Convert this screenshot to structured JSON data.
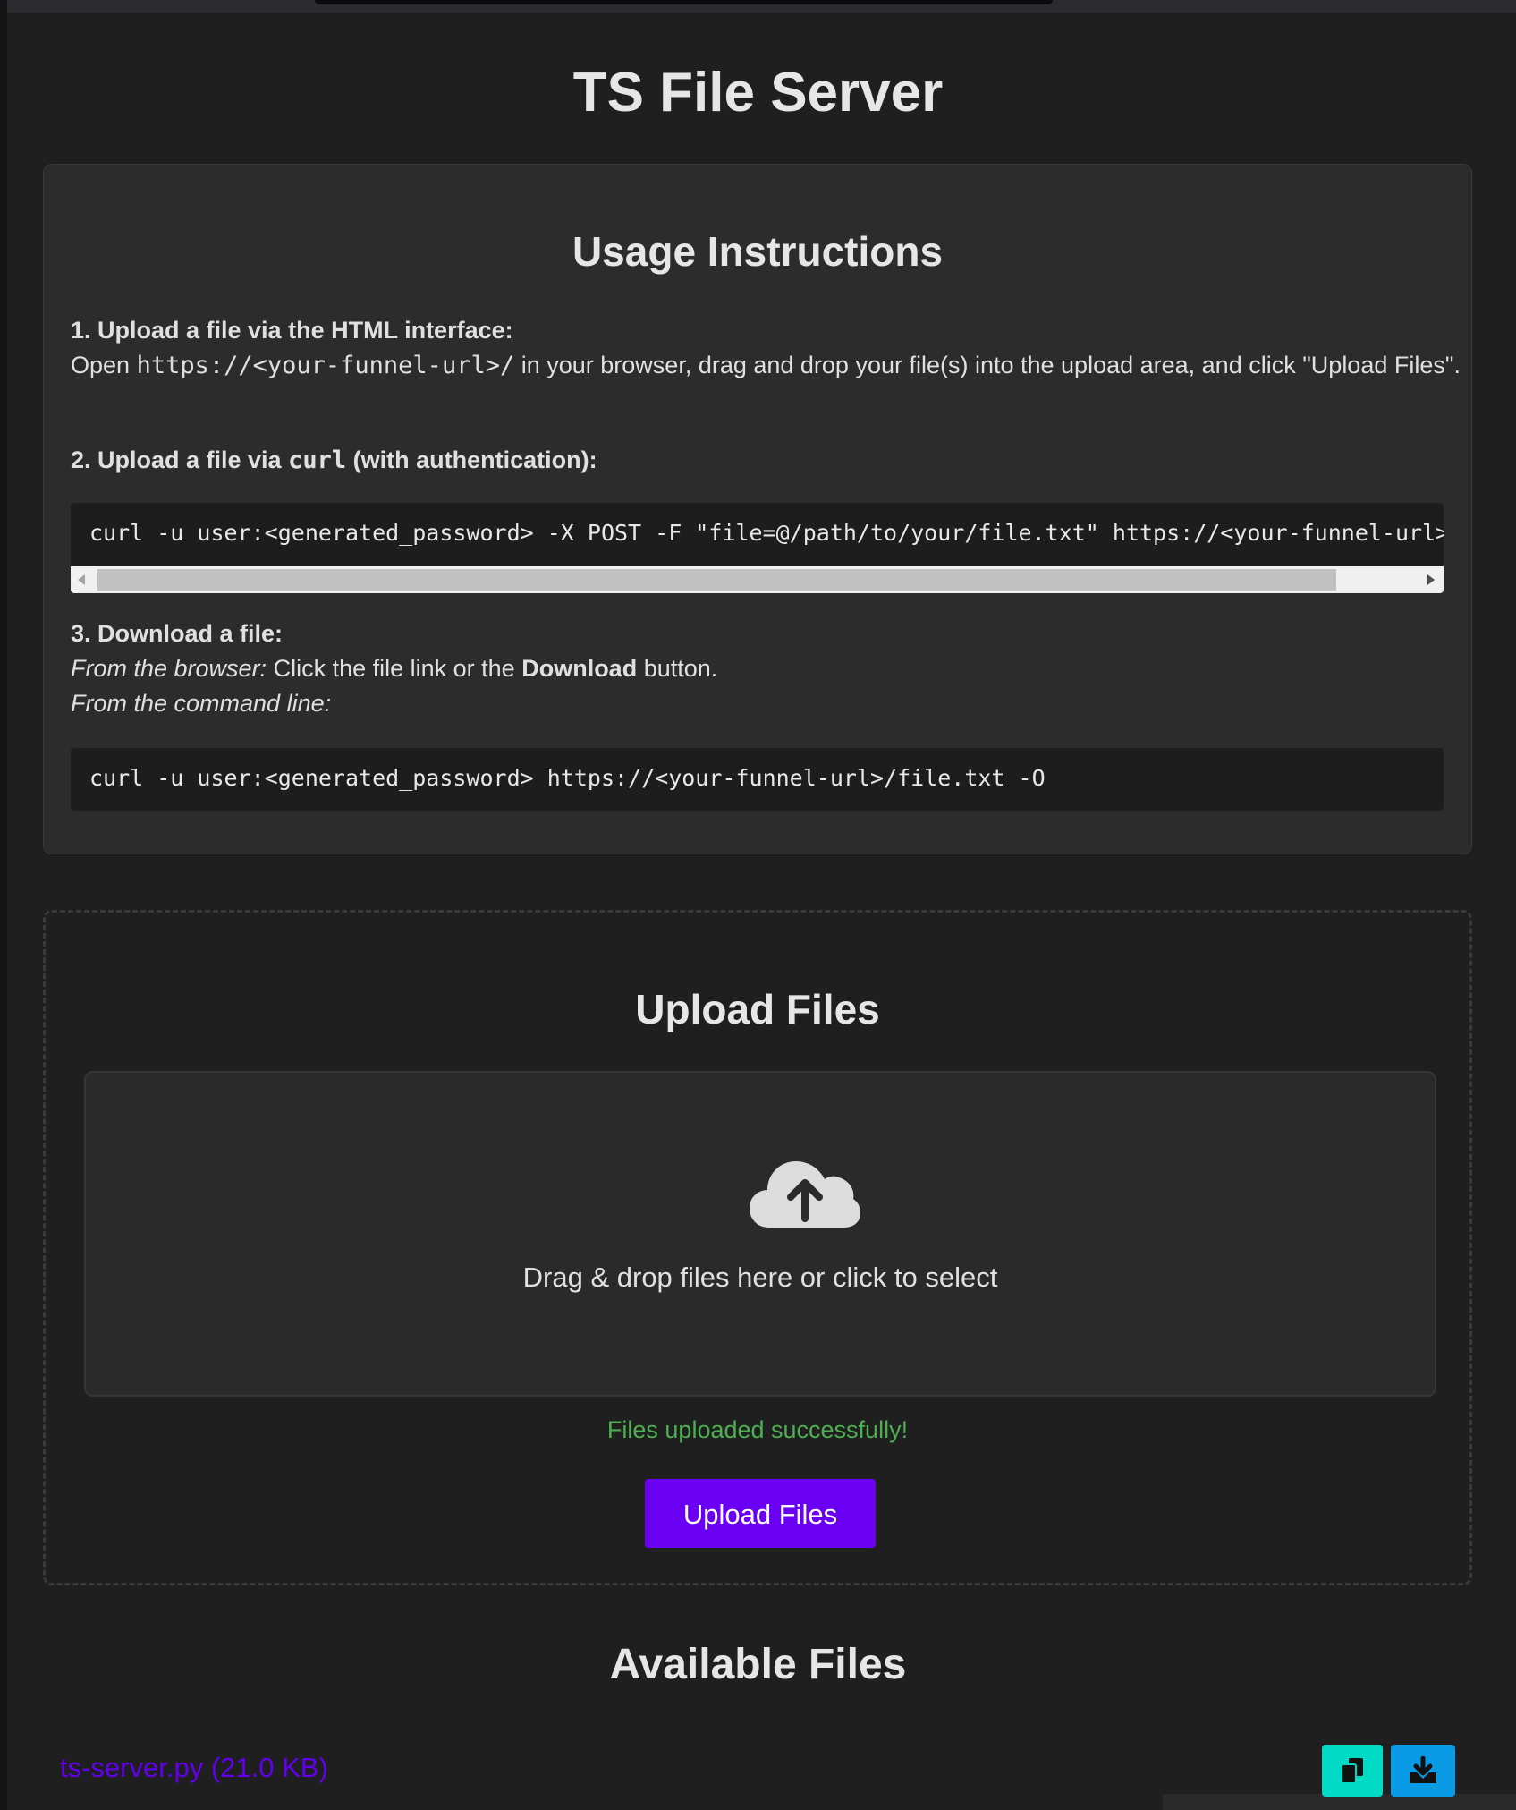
{
  "page": {
    "title": "TS File Server"
  },
  "instructions": {
    "heading": "Usage Instructions",
    "step1_title": "1. Upload a file via the HTML interface:",
    "step1_open": "Open",
    "step1_url": "https://<your-funnel-url>/",
    "step1_rest": "in your browser, drag and drop your file(s) into the upload area, and click \"Upload Files\".",
    "step2_prefix": "2. Upload a file via",
    "step2_code": "curl",
    "step2_suffix": "(with authentication):",
    "step2_command": "curl -u user:<generated_password> -X POST -F \"file=@/path/to/your/file.txt\" https://<your-funnel-url>/",
    "step3_title": "3. Download a file:",
    "step3_browser_label": "From the browser:",
    "step3_browser_text1": "Click the file link or the",
    "step3_browser_bold": "Download",
    "step3_browser_text2": "button.",
    "step3_cli_label": "From the command line:",
    "step3_command": "curl -u user:<generated_password> https://<your-funnel-url>/file.txt -O"
  },
  "upload": {
    "heading": "Upload Files",
    "drop_text": "Drag & drop files here or click to select",
    "status": "Files uploaded successfully!",
    "button": "Upload Files"
  },
  "files": {
    "heading": "Available Files",
    "items": [
      {
        "name": "ts-server.py",
        "size": "(21.0 KB)"
      }
    ]
  },
  "icons": {
    "upload": "cloud-upload-icon",
    "copy": "copy-icon",
    "download": "download-icon"
  },
  "colors": {
    "accent": "#6a00f4",
    "link": "#6200ee",
    "success": "#4caf50",
    "copy_button": "#03dac6",
    "download_button": "#0a9be6"
  }
}
